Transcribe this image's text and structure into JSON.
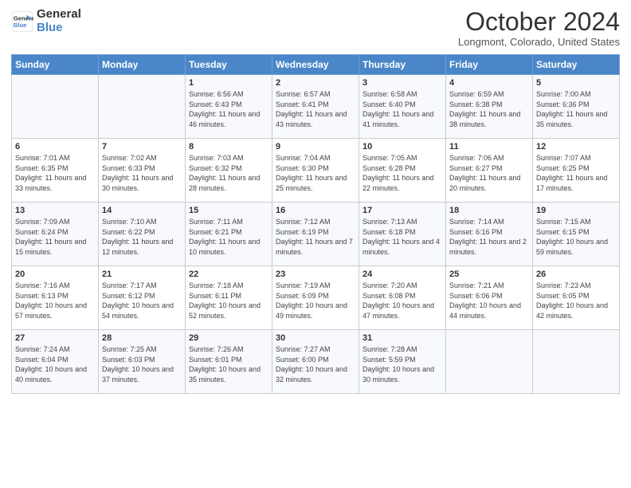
{
  "header": {
    "logo_line1": "General",
    "logo_line2": "Blue",
    "month": "October 2024",
    "location": "Longmont, Colorado, United States"
  },
  "days_of_week": [
    "Sunday",
    "Monday",
    "Tuesday",
    "Wednesday",
    "Thursday",
    "Friday",
    "Saturday"
  ],
  "weeks": [
    [
      {
        "day": "",
        "info": ""
      },
      {
        "day": "",
        "info": ""
      },
      {
        "day": "1",
        "info": "Sunrise: 6:56 AM\nSunset: 6:43 PM\nDaylight: 11 hours and 46 minutes."
      },
      {
        "day": "2",
        "info": "Sunrise: 6:57 AM\nSunset: 6:41 PM\nDaylight: 11 hours and 43 minutes."
      },
      {
        "day": "3",
        "info": "Sunrise: 6:58 AM\nSunset: 6:40 PM\nDaylight: 11 hours and 41 minutes."
      },
      {
        "day": "4",
        "info": "Sunrise: 6:59 AM\nSunset: 6:38 PM\nDaylight: 11 hours and 38 minutes."
      },
      {
        "day": "5",
        "info": "Sunrise: 7:00 AM\nSunset: 6:36 PM\nDaylight: 11 hours and 35 minutes."
      }
    ],
    [
      {
        "day": "6",
        "info": "Sunrise: 7:01 AM\nSunset: 6:35 PM\nDaylight: 11 hours and 33 minutes."
      },
      {
        "day": "7",
        "info": "Sunrise: 7:02 AM\nSunset: 6:33 PM\nDaylight: 11 hours and 30 minutes."
      },
      {
        "day": "8",
        "info": "Sunrise: 7:03 AM\nSunset: 6:32 PM\nDaylight: 11 hours and 28 minutes."
      },
      {
        "day": "9",
        "info": "Sunrise: 7:04 AM\nSunset: 6:30 PM\nDaylight: 11 hours and 25 minutes."
      },
      {
        "day": "10",
        "info": "Sunrise: 7:05 AM\nSunset: 6:28 PM\nDaylight: 11 hours and 22 minutes."
      },
      {
        "day": "11",
        "info": "Sunrise: 7:06 AM\nSunset: 6:27 PM\nDaylight: 11 hours and 20 minutes."
      },
      {
        "day": "12",
        "info": "Sunrise: 7:07 AM\nSunset: 6:25 PM\nDaylight: 11 hours and 17 minutes."
      }
    ],
    [
      {
        "day": "13",
        "info": "Sunrise: 7:09 AM\nSunset: 6:24 PM\nDaylight: 11 hours and 15 minutes."
      },
      {
        "day": "14",
        "info": "Sunrise: 7:10 AM\nSunset: 6:22 PM\nDaylight: 11 hours and 12 minutes."
      },
      {
        "day": "15",
        "info": "Sunrise: 7:11 AM\nSunset: 6:21 PM\nDaylight: 11 hours and 10 minutes."
      },
      {
        "day": "16",
        "info": "Sunrise: 7:12 AM\nSunset: 6:19 PM\nDaylight: 11 hours and 7 minutes."
      },
      {
        "day": "17",
        "info": "Sunrise: 7:13 AM\nSunset: 6:18 PM\nDaylight: 11 hours and 4 minutes."
      },
      {
        "day": "18",
        "info": "Sunrise: 7:14 AM\nSunset: 6:16 PM\nDaylight: 11 hours and 2 minutes."
      },
      {
        "day": "19",
        "info": "Sunrise: 7:15 AM\nSunset: 6:15 PM\nDaylight: 10 hours and 59 minutes."
      }
    ],
    [
      {
        "day": "20",
        "info": "Sunrise: 7:16 AM\nSunset: 6:13 PM\nDaylight: 10 hours and 57 minutes."
      },
      {
        "day": "21",
        "info": "Sunrise: 7:17 AM\nSunset: 6:12 PM\nDaylight: 10 hours and 54 minutes."
      },
      {
        "day": "22",
        "info": "Sunrise: 7:18 AM\nSunset: 6:11 PM\nDaylight: 10 hours and 52 minutes."
      },
      {
        "day": "23",
        "info": "Sunrise: 7:19 AM\nSunset: 6:09 PM\nDaylight: 10 hours and 49 minutes."
      },
      {
        "day": "24",
        "info": "Sunrise: 7:20 AM\nSunset: 6:08 PM\nDaylight: 10 hours and 47 minutes."
      },
      {
        "day": "25",
        "info": "Sunrise: 7:21 AM\nSunset: 6:06 PM\nDaylight: 10 hours and 44 minutes."
      },
      {
        "day": "26",
        "info": "Sunrise: 7:23 AM\nSunset: 6:05 PM\nDaylight: 10 hours and 42 minutes."
      }
    ],
    [
      {
        "day": "27",
        "info": "Sunrise: 7:24 AM\nSunset: 6:04 PM\nDaylight: 10 hours and 40 minutes."
      },
      {
        "day": "28",
        "info": "Sunrise: 7:25 AM\nSunset: 6:03 PM\nDaylight: 10 hours and 37 minutes."
      },
      {
        "day": "29",
        "info": "Sunrise: 7:26 AM\nSunset: 6:01 PM\nDaylight: 10 hours and 35 minutes."
      },
      {
        "day": "30",
        "info": "Sunrise: 7:27 AM\nSunset: 6:00 PM\nDaylight: 10 hours and 32 minutes."
      },
      {
        "day": "31",
        "info": "Sunrise: 7:28 AM\nSunset: 5:59 PM\nDaylight: 10 hours and 30 minutes."
      },
      {
        "day": "",
        "info": ""
      },
      {
        "day": "",
        "info": ""
      }
    ]
  ]
}
